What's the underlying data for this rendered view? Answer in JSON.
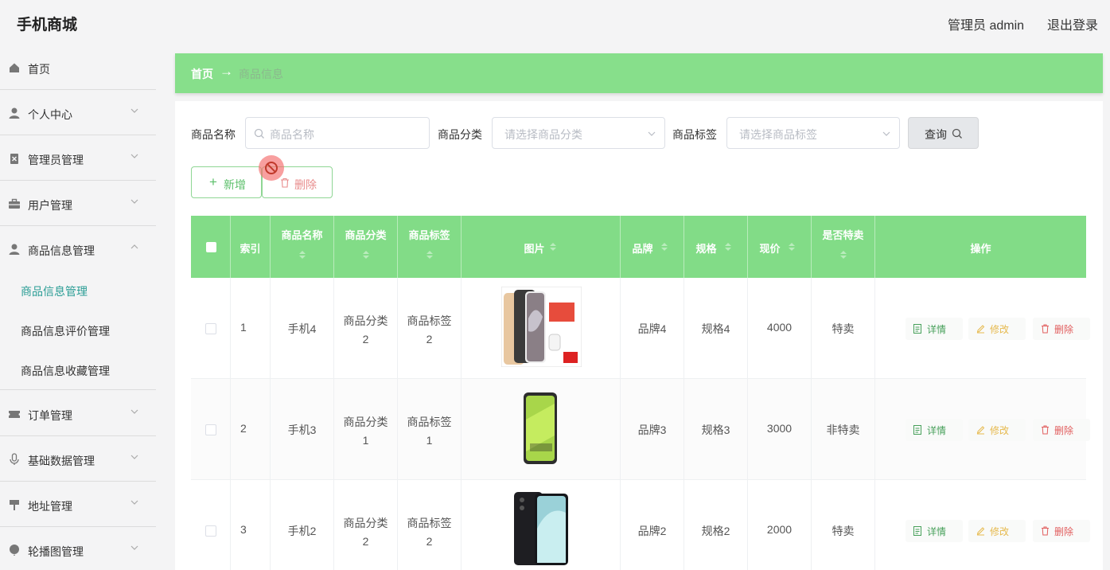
{
  "header": {
    "title": "手机商城",
    "admin": "管理员 admin",
    "logout": "退出登录"
  },
  "sidebar": {
    "items": [
      {
        "label": "首页",
        "icon": "home-icon"
      },
      {
        "label": "个人中心",
        "icon": "user-icon"
      },
      {
        "label": "管理员管理",
        "icon": "admin-icon"
      },
      {
        "label": "用户管理",
        "icon": "briefcase-icon"
      },
      {
        "label": "商品信息管理",
        "icon": "user-icon"
      },
      {
        "label": "订单管理",
        "icon": "ticket-icon"
      },
      {
        "label": "基础数据管理",
        "icon": "microphone-icon"
      },
      {
        "label": "地址管理",
        "icon": "pin-icon"
      },
      {
        "label": "轮播图管理",
        "icon": "balloon-icon"
      }
    ],
    "subitems": [
      {
        "label": "商品信息管理",
        "active": true
      },
      {
        "label": "商品信息评价管理",
        "active": false
      },
      {
        "label": "商品信息收藏管理",
        "active": false
      }
    ]
  },
  "breadcrumb": {
    "home": "首页",
    "arrow": "→",
    "current": "商品信息"
  },
  "search": {
    "name_label": "商品名称",
    "name_placeholder": "商品名称",
    "category_label": "商品分类",
    "category_placeholder": "请选择商品分类",
    "tag_label": "商品标签",
    "tag_placeholder": "请选择商品标签",
    "query_button": "查询"
  },
  "actions": {
    "add": "新增",
    "delete": "删除"
  },
  "table": {
    "headers": [
      "索引",
      "商品名称",
      "商品分类",
      "商品标签",
      "图片",
      "品牌",
      "规格",
      "现价",
      "是否特卖",
      "操作"
    ],
    "row_actions": {
      "detail": "详情",
      "edit": "修改",
      "delete": "删除"
    },
    "rows": [
      {
        "index": "1",
        "name": "手机4",
        "category": [
          "商品分类",
          "2"
        ],
        "tag": [
          "商品标签",
          "2"
        ],
        "brand": "品牌4",
        "spec": "规格4",
        "price": "4000",
        "special": "特卖"
      },
      {
        "index": "2",
        "name": "手机3",
        "category": [
          "商品分类",
          "1"
        ],
        "tag": [
          "商品标签",
          "1"
        ],
        "brand": "品牌3",
        "spec": "规格3",
        "price": "3000",
        "special": "非特卖"
      },
      {
        "index": "3",
        "name": "手机2",
        "category": [
          "商品分类",
          "2"
        ],
        "tag": [
          "商品标签",
          "2"
        ],
        "brand": "品牌2",
        "spec": "规格2",
        "price": "2000",
        "special": "特卖"
      }
    ]
  },
  "colors": {
    "accent_green": "#87df8b",
    "active_teal": "#2a9d95",
    "delete_red": "#e15d5d",
    "edit_yellow": "#e6b94d"
  }
}
